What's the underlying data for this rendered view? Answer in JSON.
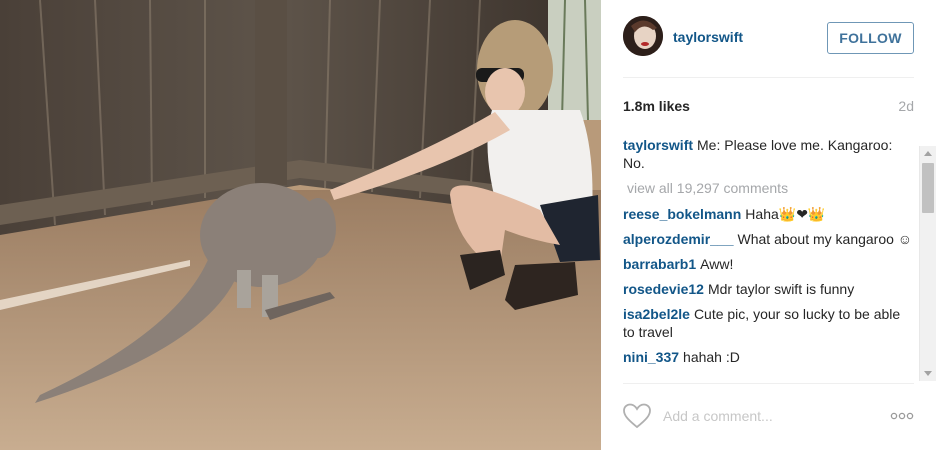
{
  "post": {
    "username": "taylorswift",
    "follow_label": "FOLLOW",
    "likes": "1.8m likes",
    "time_ago": "2d",
    "caption": {
      "user": "taylorswift",
      "text": "Me: Please love me. Kangaroo: No."
    },
    "view_all": "view all 19,297 comments",
    "comments": [
      {
        "user": "reese_bokelmann",
        "text": "Haha👑❤👑"
      },
      {
        "user": "alperozdemir___",
        "text": "What about my kangaroo ☺"
      },
      {
        "user": "barrabarb1",
        "text": "Aww!"
      },
      {
        "user": "rosedevie12",
        "text": "Mdr taylor swift is funny"
      },
      {
        "user": "isa2bel2le",
        "text": "Cute pic, your so lucky to be able to travel"
      },
      {
        "user": "nini_337",
        "text": "hahah :D"
      }
    ],
    "comment_placeholder": "Add a comment..."
  },
  "icons": {
    "heart": "heart-icon",
    "more": "more-options-icon",
    "avatar": "avatar"
  },
  "colors": {
    "username_blue": "#125688",
    "follow_blue": "#3f729b",
    "muted": "#a5a7aa"
  }
}
